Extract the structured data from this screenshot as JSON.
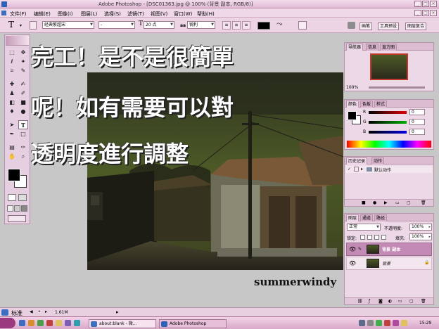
{
  "window": {
    "title": "Adobe Photoshop - [DSC01363.jpg @ 100% (背景 副本, RGB/8)]"
  },
  "menu": [
    {
      "label": "文件(F)"
    },
    {
      "label": "编辑(E)"
    },
    {
      "label": "图像(I)"
    },
    {
      "label": "图层(L)"
    },
    {
      "label": "选择(S)"
    },
    {
      "label": "滤镜(T)"
    },
    {
      "label": "视图(V)"
    },
    {
      "label": "窗口(W)"
    },
    {
      "label": "帮助(H)"
    }
  ],
  "options": {
    "tool_glyph": "T",
    "font_family": "经典繁超宋",
    "font_style": "-",
    "size_glyph": "T",
    "font_size": "20 点",
    "aa_glyph": "aa",
    "antialias": "锐利",
    "palette_tabs": [
      "画笔",
      "工具预设",
      "图层复合"
    ]
  },
  "canvas_text": {
    "line1": "完工！是不是很簡單",
    "line2": "呢！如有需要可以對",
    "line3": "透明度進行調整",
    "signature": "summerwindy"
  },
  "navigator": {
    "tabs": [
      "导航器",
      "信息",
      "直方图"
    ],
    "zoom": "100%"
  },
  "color_panel": {
    "tabs": [
      "颜色",
      "色板",
      "样式"
    ],
    "channels": [
      {
        "label": "R",
        "value": "0",
        "color": "#e00000"
      },
      {
        "label": "G",
        "value": "0",
        "color": "#00b000"
      },
      {
        "label": "B",
        "value": "0",
        "color": "#0000e0"
      }
    ]
  },
  "history": {
    "tabs": [
      "历史记录",
      "动作"
    ],
    "item": "默认动作"
  },
  "layers": {
    "tabs": [
      "图层",
      "通道",
      "路径"
    ],
    "blend_mode": "正常",
    "opacity_label": "不透明度:",
    "opacity": "100%",
    "lock_label": "锁定:",
    "fill_label": "填充:",
    "fill": "100%",
    "items": [
      {
        "name": "背景 副本",
        "selected": true
      },
      {
        "name": "背景",
        "selected": false
      }
    ]
  },
  "status": {
    "mode": "标准",
    "doc_size": "1.61M"
  },
  "taskbar": {
    "tasks": [
      "about:blank - 微...",
      "Adobe Photoshop"
    ],
    "clock": "15:29"
  },
  "colors": {
    "accent": "#e2bcd6",
    "panel": "#ecd8e6",
    "selected_layer": "#c48ab6"
  }
}
